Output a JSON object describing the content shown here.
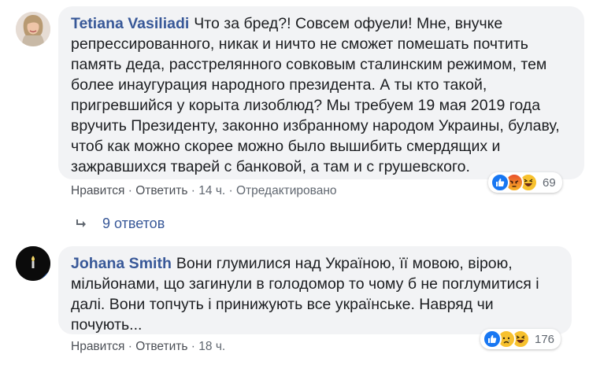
{
  "comments": [
    {
      "author": "Tetiana Vasiliadi",
      "text": "Что за бред?! Совсем офуели! Мне, внучке репрессированного, никак и ничто не сможет помешать почтить память деда, расстрелянного совковым сталинским режимом, тем более инаугурация народного президента. А ты кто такой, пригревшийся у корыта лизоблюд? Мы требуем 19 мая 2019 года вручить Президенту, законно избранному народом Украины, булаву, чтоб как можно скорее можно было вышибить смердящих и зажравшихся тварей с банковой, а там и с грушевского.",
      "reaction_count": "69",
      "reactions": [
        "like-icon",
        "angry-icon",
        "haha-icon"
      ],
      "like_label": "Нравится",
      "reply_label": "Ответить",
      "time": "14 ч.",
      "edited_label": "Отредактировано",
      "replies_label": "9 ответов"
    },
    {
      "author": "Johana Smith",
      "text": "Вони глумилися над Україною, її мовою, вірою, мільйонами, що загинули в голодомор то чому б не поглумитися і далі. Вони топчуть і принижують все українське. Навряд чи почують...",
      "reaction_count": "176",
      "reactions": [
        "like-icon",
        "sad-icon",
        "haha-icon"
      ],
      "like_label": "Нравится",
      "reply_label": "Ответить",
      "time": "18 ч."
    }
  ],
  "separator": "·",
  "colors": {
    "author": "#385898",
    "bubble": "#f2f3f5",
    "meta": "#606770",
    "like": "#1877f2"
  }
}
